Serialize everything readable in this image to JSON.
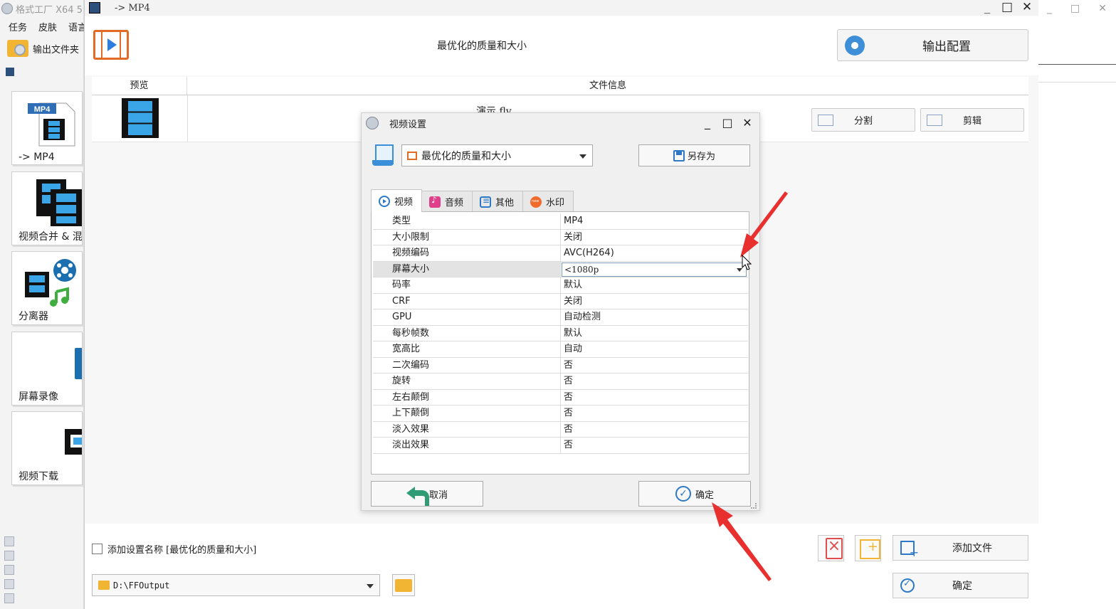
{
  "background_app": {
    "title": "格式工厂 X64 5",
    "menu": [
      "任务",
      "皮肤",
      "语言"
    ],
    "output_folder_label": "输出文件夹",
    "tiles": [
      {
        "label": "-> MP4",
        "icon": "mp4-file-icon",
        "badge": "MP4"
      },
      {
        "label": "视频合并 & 混流",
        "icon": "video-merge-icon"
      },
      {
        "label": "分离器",
        "icon": "splitter-icon"
      },
      {
        "label": "屏幕录像",
        "icon": "screen-record-icon"
      },
      {
        "label": "视频下载",
        "icon": "video-download-icon"
      }
    ]
  },
  "mp4_window": {
    "title": "-> MP4",
    "header_center": "最优化的质量和大小",
    "output_config_button": "输出配置",
    "table_headers": {
      "preview": "预览",
      "info": "文件信息"
    },
    "file": {
      "name": "演示.flv"
    },
    "split_button": "分割",
    "cut_button": "剪辑",
    "add_setting_name_label": "添加设置名称 [最优化的质量和大小]",
    "output_path": "D:\\FFOutput",
    "add_file_button": "添加文件",
    "ok_button": "确定"
  },
  "dialog": {
    "title": "视频设置",
    "preset": "最优化的质量和大小",
    "save_as_button": "另存为",
    "tabs": [
      {
        "label": "视频",
        "icon": "video-tab-icon",
        "active": true
      },
      {
        "label": "音频",
        "icon": "audio-tab-icon"
      },
      {
        "label": "其他",
        "icon": "other-tab-icon"
      },
      {
        "label": "水印",
        "icon": "watermark-tab-icon"
      }
    ],
    "properties": [
      {
        "key": "类型",
        "value": "MP4"
      },
      {
        "key": "大小限制",
        "value": "关闭"
      },
      {
        "key": "视频编码",
        "value": "AVC(H264)"
      },
      {
        "key": "屏幕大小",
        "value": "<1080p",
        "selected": true
      },
      {
        "key": "码率",
        "value": "默认"
      },
      {
        "key": "CRF",
        "value": "关闭"
      },
      {
        "key": "GPU",
        "value": "自动检测"
      },
      {
        "key": "每秒帧数",
        "value": "默认"
      },
      {
        "key": "宽高比",
        "value": "自动"
      },
      {
        "key": "二次编码",
        "value": "否"
      },
      {
        "key": "旋转",
        "value": "否"
      },
      {
        "key": "左右颠倒",
        "value": "否"
      },
      {
        "key": "上下颠倒",
        "value": "否"
      },
      {
        "key": "淡入效果",
        "value": "否"
      },
      {
        "key": "淡出效果",
        "value": "否"
      }
    ],
    "cancel_button": "取消",
    "ok_button": "确定"
  },
  "colors": {
    "accent_blue": "#2d79c7",
    "film_orange": "#e46b25",
    "arrow_red": "#e8312f",
    "folder_yellow": "#f2b533"
  }
}
